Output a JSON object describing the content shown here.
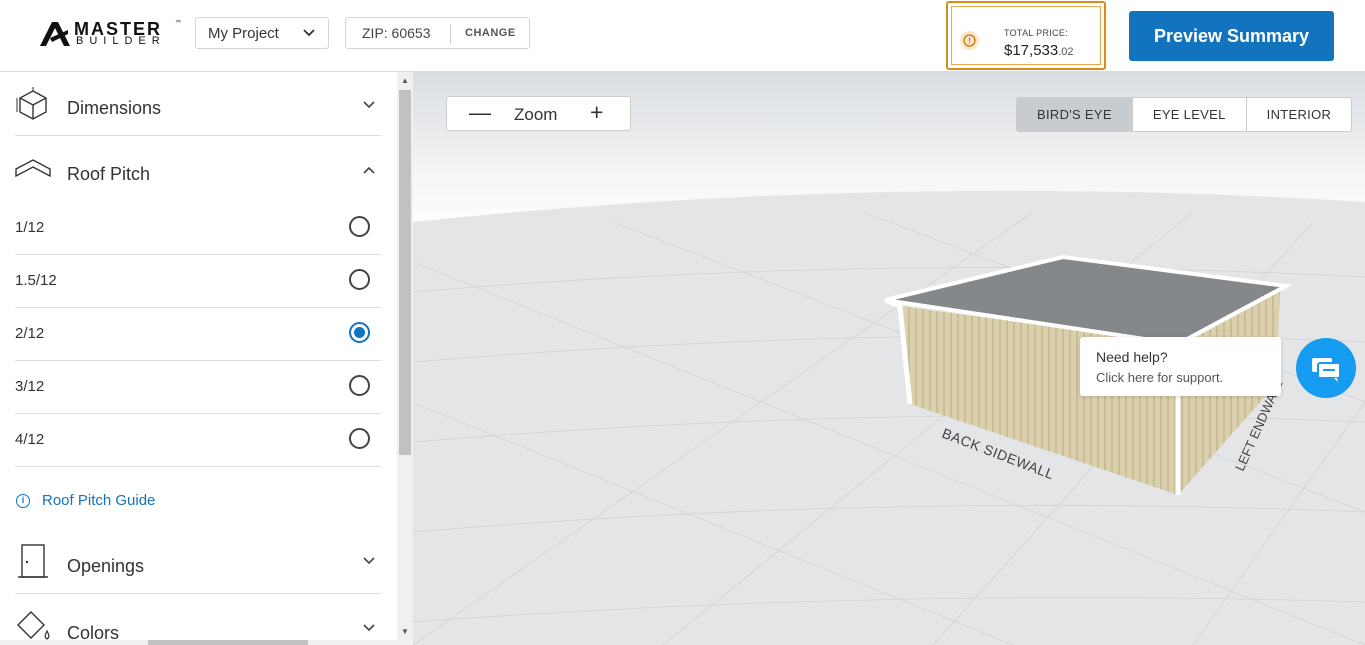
{
  "header": {
    "logo_top": "MASTER",
    "logo_bottom": "BUILDER",
    "logo_tm": "™",
    "project_name": "My Project",
    "zip_label": "ZIP: 60653",
    "zip_change": "CHANGE",
    "price_label": "TOTAL PRICE:",
    "price_main": "$17,533",
    "price_cents": ".02",
    "preview_button": "Preview Summary"
  },
  "sidebar": {
    "sections": {
      "dimensions": "Dimensions",
      "roof_pitch": "Roof Pitch",
      "openings": "Openings",
      "colors": "Colors"
    },
    "pitch_options": [
      {
        "label": "1/12",
        "selected": false
      },
      {
        "label": "1.5/12",
        "selected": false
      },
      {
        "label": "2/12",
        "selected": true
      },
      {
        "label": "3/12",
        "selected": false
      },
      {
        "label": "4/12",
        "selected": false
      }
    ],
    "guide_link": "Roof Pitch Guide"
  },
  "viewport": {
    "zoom_minus": "—",
    "zoom_label": "Zoom",
    "zoom_plus": "+",
    "views": [
      "BIRD'S EYE",
      "EYE LEVEL",
      "INTERIOR"
    ],
    "active_view": "BIRD'S EYE",
    "wall_labels": {
      "back": "BACK SIDEWALL",
      "left": "LEFT ENDWALL"
    },
    "help_title": "Need help?",
    "help_sub": "Click here for support."
  },
  "colors": {
    "accent": "#1273bf",
    "price_border": "#d98a1a",
    "chat": "#159bef",
    "wall": "#d9cfae",
    "roof": "#888b8e"
  }
}
